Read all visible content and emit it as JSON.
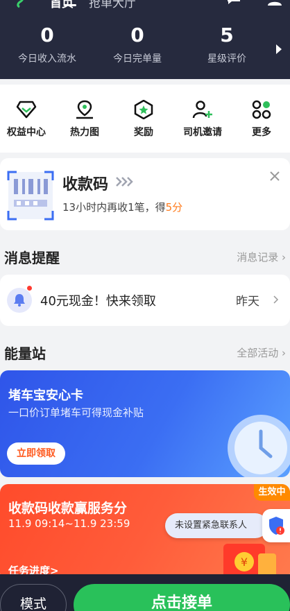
{
  "header": {
    "tabs": [
      {
        "label": "首页",
        "active": true
      },
      {
        "label": "抢单大厅",
        "active": false
      }
    ],
    "stats": [
      {
        "value": "0",
        "label": "今日收入流水"
      },
      {
        "value": "0",
        "label": "今日完单量"
      },
      {
        "value": "5",
        "label": "星级评价"
      }
    ],
    "icons": [
      "logo-icon",
      "message-icon",
      "user-icon",
      "chevron-right-icon"
    ]
  },
  "shortcuts": [
    {
      "label": "权益中心",
      "icon": "diamond-icon"
    },
    {
      "label": "热力图",
      "icon": "map-pin-icon"
    },
    {
      "label": "奖励",
      "icon": "star-badge-icon"
    },
    {
      "label": "司机邀请",
      "icon": "add-user-icon"
    },
    {
      "label": "更多",
      "icon": "grid-dots-icon"
    }
  ],
  "paycode": {
    "title": "收款码",
    "desc_prefix": "13小时内再收1笔，得",
    "desc_highlight": "5分"
  },
  "messages": {
    "title": "消息提醒",
    "link": "消息记录",
    "item": {
      "text": "40元现金！快来领取",
      "time": "昨天"
    }
  },
  "energy": {
    "title": "能量站",
    "link": "全部活动",
    "banner1": {
      "title": "堵车宝安心卡",
      "subtitle": "一口价订单堵车可得现金补贴",
      "button": "立即领取"
    },
    "banner2": {
      "title": "收款码收款赢服务分",
      "time": "11.9 09:14~11.9 23:59",
      "task": "任务进度>",
      "badge": "生效中"
    }
  },
  "tooltip": "未设置紧急联系人",
  "bottom": {
    "mode": "模式",
    "accept": "点击接单"
  },
  "colors": {
    "header_bg": "#262a3e",
    "accent_green": "#29c15a",
    "highlight_orange": "#ff7a1a",
    "banner_blue": "#3b6ef3",
    "banner_red": "#ff4b2b"
  }
}
